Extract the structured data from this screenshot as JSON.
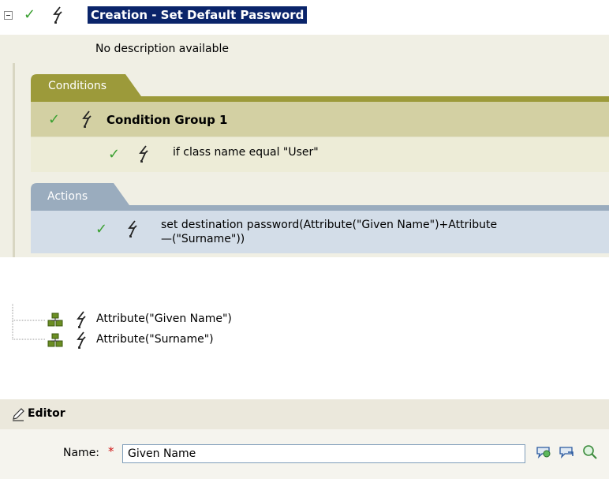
{
  "rule": {
    "title": "Creation - Set Default Password",
    "description": "No description available",
    "conditions": {
      "tab_label": "Conditions",
      "group_label": "Condition Group 1",
      "condition_text": "if class name equal \"User\""
    },
    "actions": {
      "tab_label": "Actions",
      "action_line1": "set destination password(Attribute(\"Given Name\")+Attribute",
      "action_line2": "—(\"Surname\"))"
    }
  },
  "tree": {
    "items": [
      {
        "label": "Attribute(\"Given Name\")",
        "icon": "tree-node-icon"
      },
      {
        "label": "Attribute(\"Surname\")",
        "icon": "tree-node-icon"
      }
    ]
  },
  "editor": {
    "title": "Editor",
    "name_label": "Name:",
    "required_marker": "*",
    "name_value": "Given Name",
    "buttons": [
      "browse-data-icon",
      "browse-schema-icon",
      "search-icon"
    ]
  },
  "colors": {
    "selection": "#0a246a",
    "check": "#3aa031",
    "conditions_tab": "#9c9a3a",
    "actions_tab": "#9aacbe",
    "required": "#d01414"
  }
}
